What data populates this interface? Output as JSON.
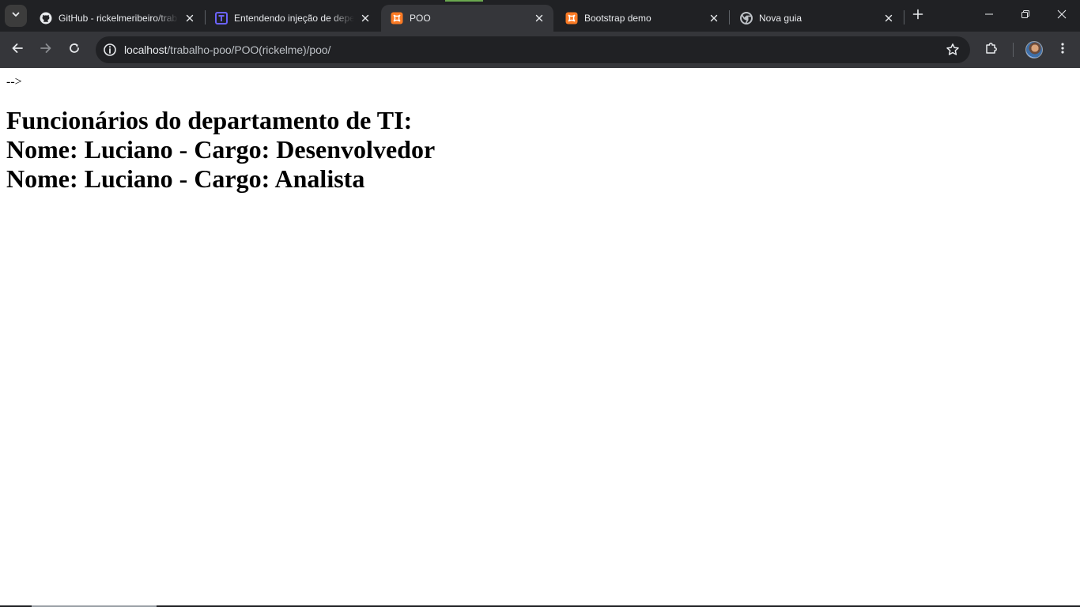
{
  "tabs": [
    {
      "title": "GitHub - rickelmeribeiro/trab",
      "icon": "github-icon",
      "active": false
    },
    {
      "title": "Entendendo injeção de depe",
      "icon": "treinaweb-icon",
      "active": false
    },
    {
      "title": "POO",
      "icon": "xampp-icon",
      "active": true
    },
    {
      "title": "Bootstrap demo",
      "icon": "xampp-icon",
      "active": false
    },
    {
      "title": "Nova guia",
      "icon": "chrome-icon",
      "active": false
    }
  ],
  "address_bar": {
    "host": "localhost",
    "path": "/trabalho-poo/POO(rickelme)/poo/"
  },
  "page": {
    "comment_text": "-->",
    "heading": "Funcionários do departamento de TI:",
    "employees": [
      "Nome: Luciano - Cargo: Desenvolvedor",
      "Nome: Luciano - Cargo: Analista"
    ]
  },
  "colors": {
    "tabstrip_bg": "#202124",
    "toolbar_bg": "#35363a",
    "xampp_orange": "#fb7a24",
    "active_indicator": "#6aa84f"
  }
}
